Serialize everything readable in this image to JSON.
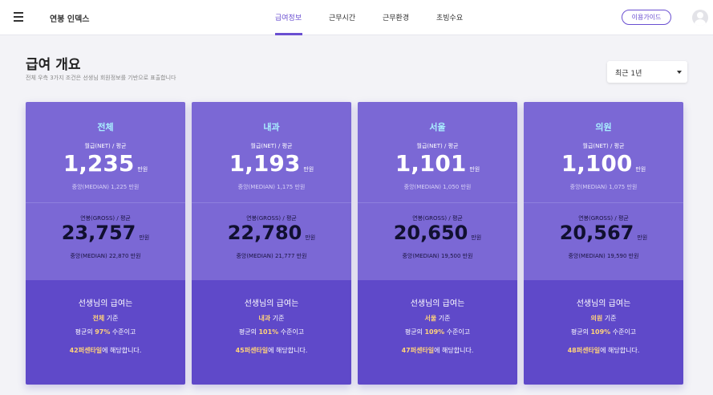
{
  "header": {
    "title": "연봉 인덱스",
    "tabs": [
      {
        "label": "급여정보",
        "active": true
      },
      {
        "label": "근무시간",
        "active": false
      },
      {
        "label": "근무환경",
        "active": false
      },
      {
        "label": "초빙수요",
        "active": false
      }
    ],
    "guide_label": "이용가이드"
  },
  "main": {
    "title": "급여 개요",
    "subtitle": "전체 우측 3가지 조건은 선생님 회원정보를 기반으로 표출합니다",
    "period": "최근 1년"
  },
  "labels": {
    "net": "월급(NET) / 평균",
    "gross": "연봉(GROSS) / 평균",
    "unit": "만원",
    "summary_heading": "선생님의 급여는",
    "basis_suffix": " 기준",
    "avg_prefix": "평균의 ",
    "avg_suffix": " 수준이고",
    "pct_suffix": "에 해당합니다."
  },
  "cards": [
    {
      "name": "전체",
      "net": "1,235",
      "net_median": "중앙(MEDIAN) 1,225 만원",
      "gross": "23,757",
      "gross_median": "중앙(MEDIAN) 22,870 만원",
      "pct_of_avg": "97%",
      "percentile": "42퍼센타일"
    },
    {
      "name": "내과",
      "net": "1,193",
      "net_median": "중앙(MEDIAN) 1,175 만원",
      "gross": "22,780",
      "gross_median": "중앙(MEDIAN) 21,777 만원",
      "pct_of_avg": "101%",
      "percentile": "45퍼센타일"
    },
    {
      "name": "서울",
      "net": "1,101",
      "net_median": "중앙(MEDIAN) 1,050 만원",
      "gross": "20,650",
      "gross_median": "중앙(MEDIAN) 19,500 만원",
      "pct_of_avg": "109%",
      "percentile": "47퍼센타일"
    },
    {
      "name": "의원",
      "net": "1,100",
      "net_median": "중앙(MEDIAN) 1,075 만원",
      "gross": "20,567",
      "gross_median": "중앙(MEDIAN) 19,590 만원",
      "pct_of_avg": "109%",
      "percentile": "48퍼센타일"
    }
  ],
  "colors": {
    "accent": "#6a4fd1",
    "card_top": "#7b68d5",
    "card_bottom": "#5f49c9",
    "highlight": "#ffd27a",
    "card_name": "#a9f0ff"
  }
}
